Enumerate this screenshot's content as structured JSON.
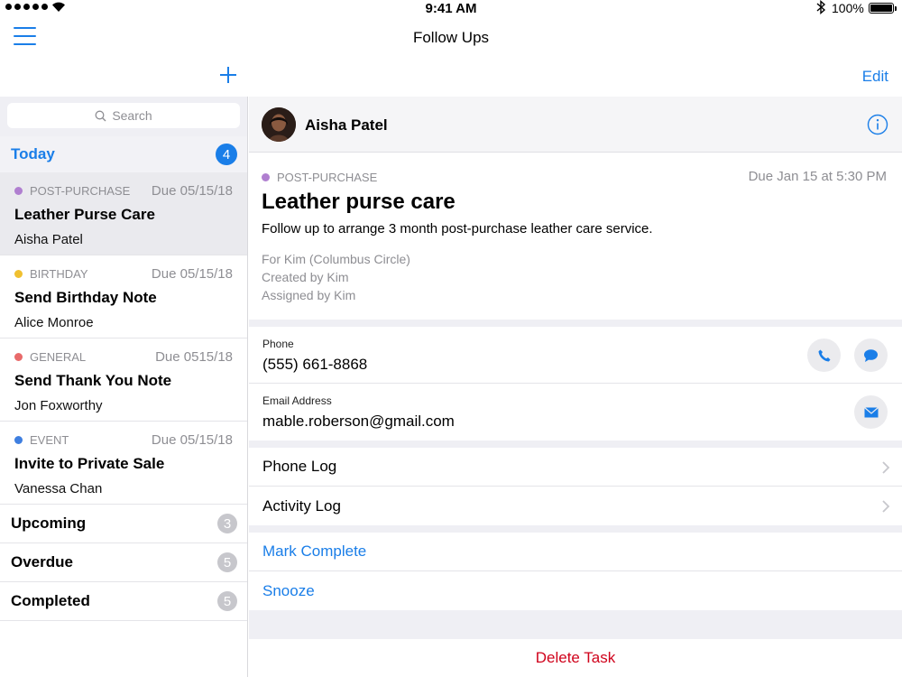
{
  "status_bar": {
    "time": "9:41 AM",
    "battery": "100%"
  },
  "nav": {
    "title": "Follow Ups",
    "edit_label": "Edit"
  },
  "search": {
    "placeholder": "Search"
  },
  "today": {
    "label": "Today",
    "count": "4"
  },
  "tasks": [
    {
      "category": "POST-PURCHASE",
      "category_color": "#b07fd0",
      "due": "Due 05/15/18",
      "title": "Leather Purse Care",
      "person": "Aisha Patel",
      "selected": true
    },
    {
      "category": "BIRTHDAY",
      "category_color": "#f0c030",
      "due": "Due 05/15/18",
      "title": "Send Birthday Note",
      "person": "Alice Monroe",
      "selected": false
    },
    {
      "category": "GENERAL",
      "category_color": "#e86a6a",
      "due": "Due 0515/18",
      "title": "Send Thank You Note",
      "person": "Jon Foxworthy",
      "selected": false
    },
    {
      "category": "EVENT",
      "category_color": "#3f7fe0",
      "due": "Due 05/15/18",
      "title": "Invite to Private Sale",
      "person": "Vanessa Chan",
      "selected": false
    }
  ],
  "groups": [
    {
      "label": "Upcoming",
      "count": "3"
    },
    {
      "label": "Overdue",
      "count": "5"
    },
    {
      "label": "Completed",
      "count": "5"
    }
  ],
  "detail": {
    "contact_name": "Aisha Patel",
    "category": "POST-PURCHASE",
    "category_color": "#b07fd0",
    "due": "Due Jan 15 at 5:30 PM",
    "title": "Leather purse care",
    "description": "Follow up to arrange 3 month post-purchase leather care service.",
    "for": "For Kim (Columbus Circle)",
    "created_by": "Created by Kim",
    "assigned_by": "Assigned by Kim",
    "phone_label": "Phone",
    "phone": "(555) 661-8868",
    "email_label": "Email Address",
    "email": "mable.roberson@gmail.com",
    "phone_log": "Phone Log",
    "activity_log": "Activity Log",
    "mark_complete": "Mark Complete",
    "snooze": "Snooze",
    "delete_task": "Delete Task"
  },
  "colors": {
    "accent": "#1a7ee8",
    "destructive": "#d0021b",
    "badge_grey": "#c7c7cc"
  }
}
